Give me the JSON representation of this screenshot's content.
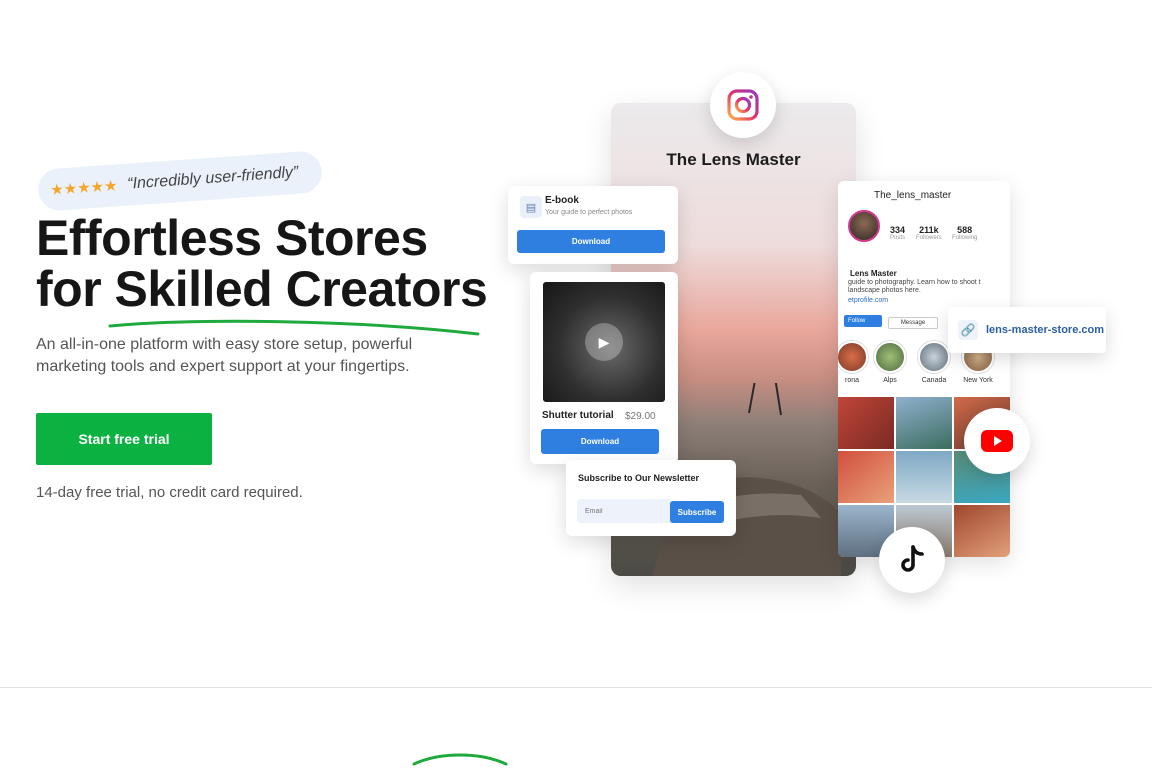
{
  "badge": {
    "stars": "★★★★★",
    "quote": "“Incredibly user-friendly”"
  },
  "headline": {
    "line1": "Effortless Stores",
    "line2": "for Skilled Creators"
  },
  "subtext": "An all-in-one platform with easy store setup, powerful marketing tools and expert support at your fingertips.",
  "cta": {
    "label": "Start free trial"
  },
  "trial_note": "14-day free trial, no credit card required.",
  "profile": {
    "title": "The Lens Master"
  },
  "ebook": {
    "title": "E-book",
    "subtitle": "Your guide to perfect photos",
    "button": "Download"
  },
  "tutorial": {
    "title": "Shutter tutorial",
    "price": "$29.00",
    "button": "Download"
  },
  "newsletter": {
    "title": "Subscribe to Our Newsletter",
    "email_placeholder": "Email",
    "button": "Subscribe"
  },
  "link_pill": {
    "text": "lens-master-store.com"
  },
  "feed": {
    "username": "The_lens_master",
    "stats": [
      {
        "value": "334",
        "label": "Posts"
      },
      {
        "value": "211k",
        "label": "Followers"
      },
      {
        "value": "588",
        "label": "Following"
      }
    ],
    "bio_name": "Lens Master",
    "bio_text": "guide to photography. Learn how to shoot t landscape photos here.",
    "bio_link": "etprofile.com",
    "follow": "Follow",
    "message": "Message",
    "highlights": [
      "rona",
      "Alps",
      "Canada",
      "New York"
    ]
  },
  "icons": {
    "instagram": "instagram-icon",
    "youtube": "youtube-icon",
    "tiktok": "tiktok-icon"
  },
  "colors": {
    "accent_green": "#0cb241",
    "accent_blue": "#2f7fe0",
    "badge_bg": "#eaf1fb"
  }
}
